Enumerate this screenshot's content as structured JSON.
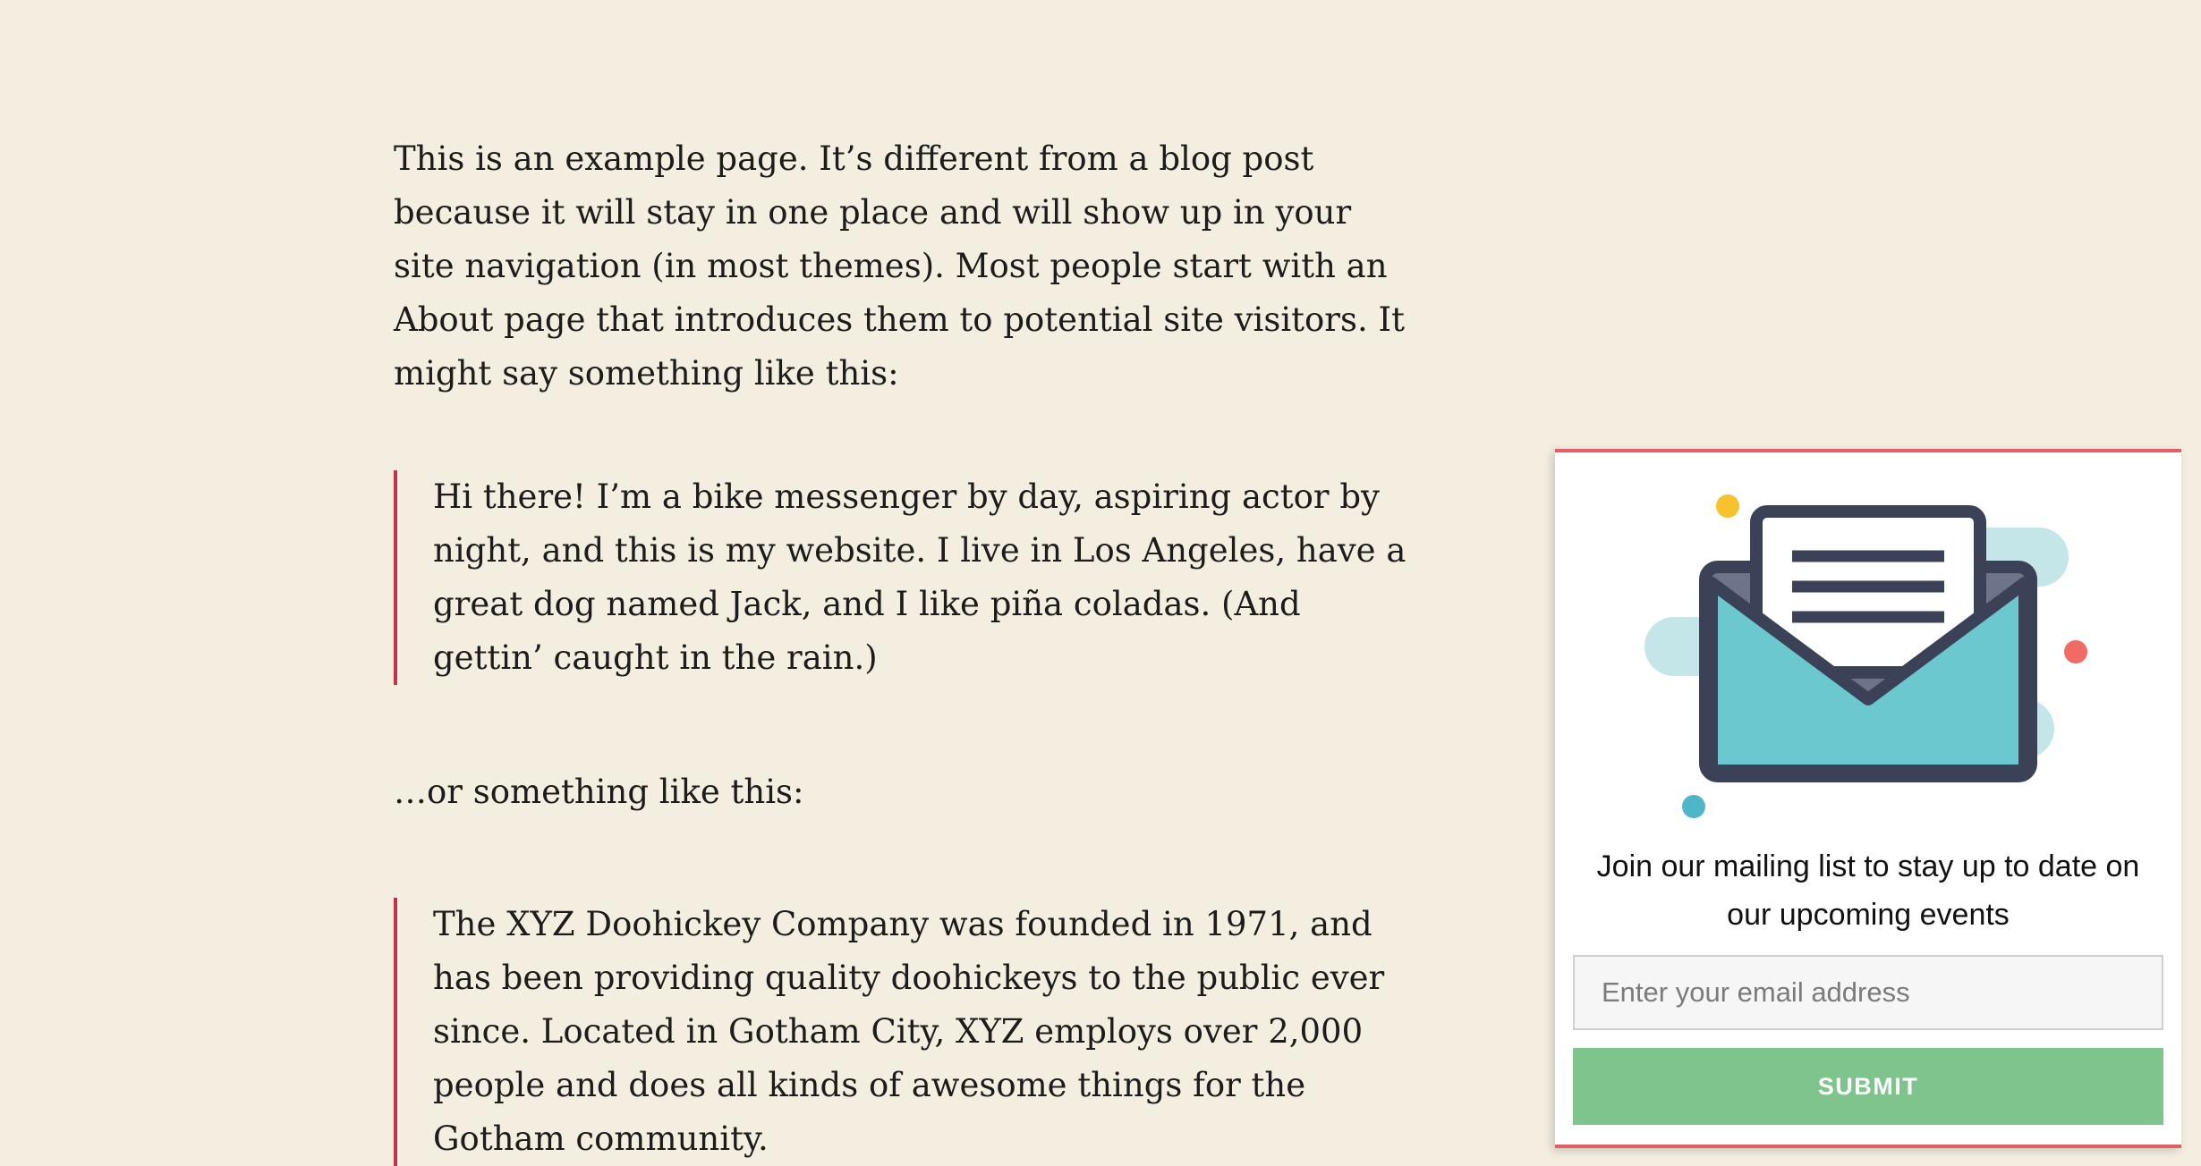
{
  "content": {
    "intro": "This is an example page. It’s different from a blog post because it will stay in one place and will show up in your site navigation (in most themes). Most people start with an About page that introduces them to potential site visitors. It might say something like this:",
    "quote1": "Hi there! I’m a bike messenger by day, aspiring actor by night, and this is my website. I live in Los Angeles, have a great dog named Jack, and I like piña coladas. (And gettin’ caught in the rain.)",
    "middle": "…or something like this:",
    "quote2": "The XYZ Doohickey Company was founded in 1971, and has been providing quality doohickeys to the public ever since. Located in Gotham City, XYZ employs over 2,000 people and does all kinds of awesome things for the Gotham community."
  },
  "newsletter": {
    "illustration_icon": "envelope-letter-illustration",
    "text": "Join our mailing list to stay up to date on our upcoming events",
    "email_placeholder": "Enter your email address",
    "email_value": "",
    "submit_label": "SUBMIT"
  },
  "colors": {
    "background": "#f4eee0",
    "quote_border": "#c7304b",
    "widget_border": "#e35f65",
    "submit_button": "#80c48d",
    "envelope": "#6bc8cf",
    "envelope_outline": "#3b4257"
  }
}
